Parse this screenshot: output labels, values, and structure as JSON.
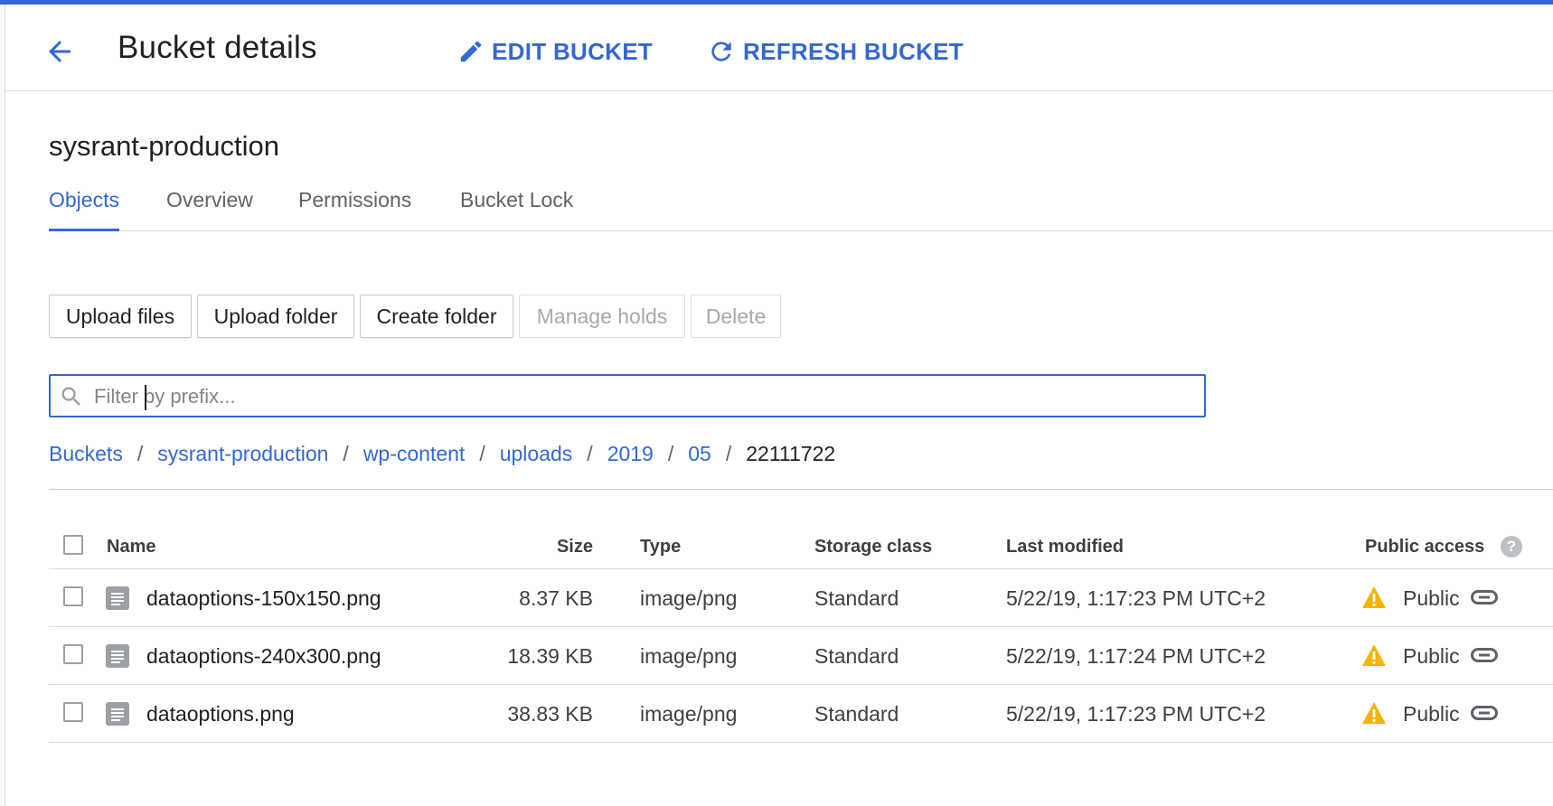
{
  "colors": {
    "accent": "#3367d6",
    "warning": "#f4b400",
    "text": "#202124",
    "muted": "#5f6368"
  },
  "header": {
    "title": "Bucket details",
    "back_icon": "arrow-left-icon",
    "edit_label": "EDIT BUCKET",
    "edit_icon": "pencil-icon",
    "refresh_label": "REFRESH BUCKET",
    "refresh_icon": "refresh-icon"
  },
  "bucket_name": "sysrant-production",
  "tabs": [
    {
      "label": "Objects",
      "active": true
    },
    {
      "label": "Overview",
      "active": false
    },
    {
      "label": "Permissions",
      "active": false
    },
    {
      "label": "Bucket Lock",
      "active": false
    }
  ],
  "toolbar": {
    "upload_files": "Upload files",
    "upload_folder": "Upload folder",
    "create_folder": "Create folder",
    "manage_holds": "Manage holds",
    "delete": "Delete"
  },
  "filter": {
    "placeholder": "Filter by prefix...",
    "value": ""
  },
  "breadcrumb": {
    "separator": "/",
    "links": [
      "Buckets",
      "sysrant-production",
      "wp-content",
      "uploads",
      "2019",
      "05"
    ],
    "current": "22111722"
  },
  "table": {
    "columns": {
      "name": "Name",
      "size": "Size",
      "type": "Type",
      "storage_class": "Storage class",
      "last_modified": "Last modified",
      "public_access": "Public access"
    },
    "help_glyph": "?",
    "rows": [
      {
        "name": "dataoptions-150x150.png",
        "size": "8.37 KB",
        "type": "image/png",
        "storage_class": "Standard",
        "last_modified": "5/22/19, 1:17:23 PM UTC+2",
        "public_access": "Public"
      },
      {
        "name": "dataoptions-240x300.png",
        "size": "18.39 KB",
        "type": "image/png",
        "storage_class": "Standard",
        "last_modified": "5/22/19, 1:17:24 PM UTC+2",
        "public_access": "Public"
      },
      {
        "name": "dataoptions.png",
        "size": "38.83 KB",
        "type": "image/png",
        "storage_class": "Standard",
        "last_modified": "5/22/19, 1:17:23 PM UTC+2",
        "public_access": "Public"
      }
    ]
  }
}
